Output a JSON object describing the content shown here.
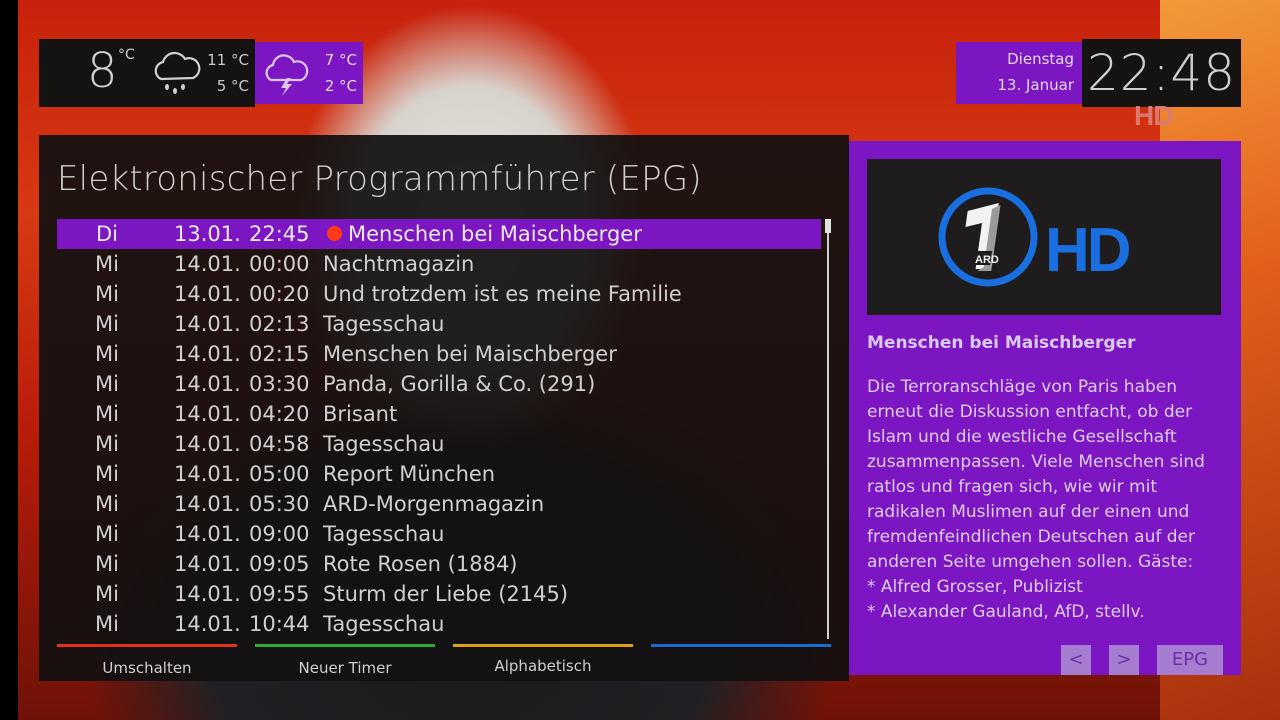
{
  "weather": {
    "now": {
      "temp": "8",
      "unit": "°C",
      "icon": "rain-cloud-icon",
      "high": "11 °C",
      "low": "5 °C"
    },
    "tomorrow": {
      "icon": "thunderstorm-cloud-icon",
      "high": "7 °C",
      "low": "2 °C"
    }
  },
  "clock": {
    "weekday": "Dienstag",
    "date": "13. Januar",
    "time": "22:48"
  },
  "channel_watermark": "HD",
  "epg": {
    "title": "Elektronischer Programmführer (EPG)",
    "rows": [
      {
        "day": "Di",
        "date": "13.01.",
        "time": "22:45",
        "title": "Menschen bei Maischberger",
        "selected": true,
        "recording": true
      },
      {
        "day": "Mi",
        "date": "14.01.",
        "time": "00:00",
        "title": "Nachtmagazin"
      },
      {
        "day": "Mi",
        "date": "14.01.",
        "time": "00:20",
        "title": "Und trotzdem ist es meine Familie"
      },
      {
        "day": "Mi",
        "date": "14.01.",
        "time": "02:13",
        "title": "Tagesschau"
      },
      {
        "day": "Mi",
        "date": "14.01.",
        "time": "02:15",
        "title": "Menschen bei Maischberger"
      },
      {
        "day": "Mi",
        "date": "14.01.",
        "time": "03:30",
        "title": "Panda, Gorilla & Co. (291)"
      },
      {
        "day": "Mi",
        "date": "14.01.",
        "time": "04:20",
        "title": "Brisant"
      },
      {
        "day": "Mi",
        "date": "14.01.",
        "time": "04:58",
        "title": "Tagesschau"
      },
      {
        "day": "Mi",
        "date": "14.01.",
        "time": "05:00",
        "title": "Report München"
      },
      {
        "day": "Mi",
        "date": "14.01.",
        "time": "05:30",
        "title": "ARD-Morgenmagazin"
      },
      {
        "day": "Mi",
        "date": "14.01.",
        "time": "09:00",
        "title": "Tagesschau"
      },
      {
        "day": "Mi",
        "date": "14.01.",
        "time": "09:05",
        "title": "Rote Rosen (1884)"
      },
      {
        "day": "Mi",
        "date": "14.01.",
        "time": "09:55",
        "title": "Sturm der Liebe (2145)"
      },
      {
        "day": "Mi",
        "date": "14.01.",
        "time": "10:44",
        "title": "Tagesschau"
      }
    ],
    "buttons": {
      "red": "Umschalten",
      "green": "Neuer Timer",
      "yellow": "Alphabetisch",
      "blue": ""
    }
  },
  "info": {
    "channel_logo": {
      "icon": "das-erste-hd-logo",
      "badge": "ARD",
      "hd": "HD"
    },
    "title": "Menschen bei Maischberger",
    "description": "Die Terroranschläge von Paris haben erneut die Diskussion entfacht, ob der Islam und die westliche Gesellschaft zusammenpassen. Viele Menschen sind ratlos und fragen sich, wie wir mit radikalen Muslimen auf der einen und fremdenfeindlichen Deutschen auf der anderen Seite umgehen sollen. Gäste:\n* Alfred Grosser, Publizist\n* Alexander Gauland, AfD, stellv.",
    "nav": {
      "prev": "<",
      "next": ">",
      "epg": "EPG"
    }
  },
  "colors": {
    "accent": "#7b16c2",
    "panel": "#151212",
    "red": "#e0341a",
    "green": "#2fa83a",
    "yellow": "#e0a020",
    "blue": "#1a6cd0",
    "logo_blue": "#1a6fe0"
  }
}
